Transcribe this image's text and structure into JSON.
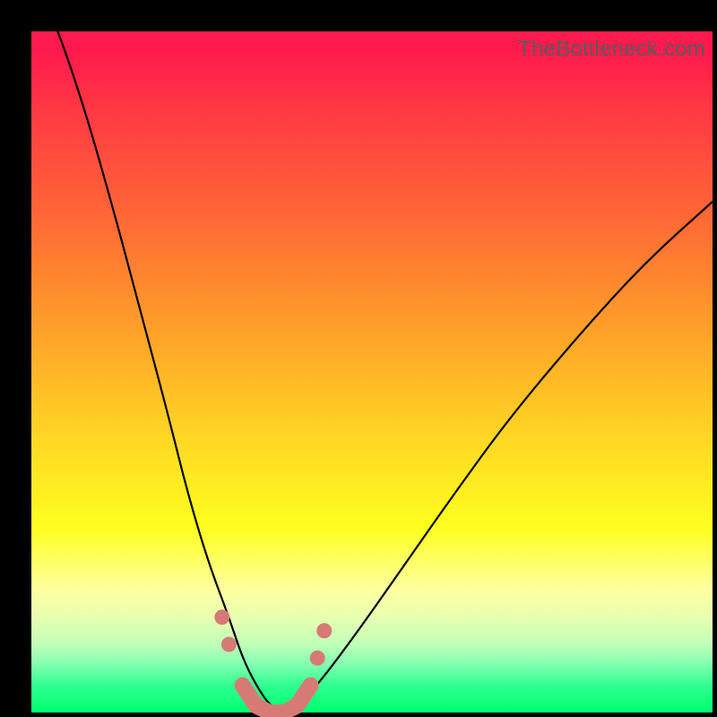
{
  "watermark": "TheBottleneck.com",
  "colors": {
    "frame": "#000000",
    "top_gradient": "#ff1a4d",
    "mid_gradient": "#ffff20",
    "bottom_gradient": "#00ff70",
    "curve": "#000000",
    "marker": "#d77a76",
    "watermark_text": "#5a5a5a"
  },
  "chart_data": {
    "type": "line",
    "title": "",
    "xlabel": "",
    "ylabel": "",
    "xlim": [
      0,
      100
    ],
    "ylim": [
      0,
      100
    ],
    "grid": false,
    "legend_position": "none",
    "annotations": [
      "TheBottleneck.com"
    ],
    "series": [
      {
        "name": "bottleneck-curve",
        "x": [
          0,
          4,
          8,
          12,
          16,
          20,
          23,
          26,
          29,
          31,
          33,
          35,
          37,
          39,
          42,
          48,
          55,
          62,
          70,
          80,
          90,
          100
        ],
        "y": [
          110,
          100,
          88,
          74,
          59,
          44,
          32,
          22,
          14,
          8,
          4,
          1,
          0,
          1,
          4,
          12,
          22,
          32,
          43,
          55,
          66,
          75
        ]
      },
      {
        "name": "highlight-markers",
        "x": [
          28,
          29,
          31,
          33,
          35,
          37,
          39,
          41,
          42,
          43
        ],
        "y": [
          14,
          10,
          4,
          1,
          0,
          0,
          1,
          4,
          8,
          12
        ]
      }
    ],
    "notes": "V-shaped bottleneck curve over a red→yellow→green gradient. y values are percentage bottleneck (0 at valley, ~100 at top). x is a relative hardware index (0–100). Markers highlight the near-optimal region around x≈28–43."
  }
}
